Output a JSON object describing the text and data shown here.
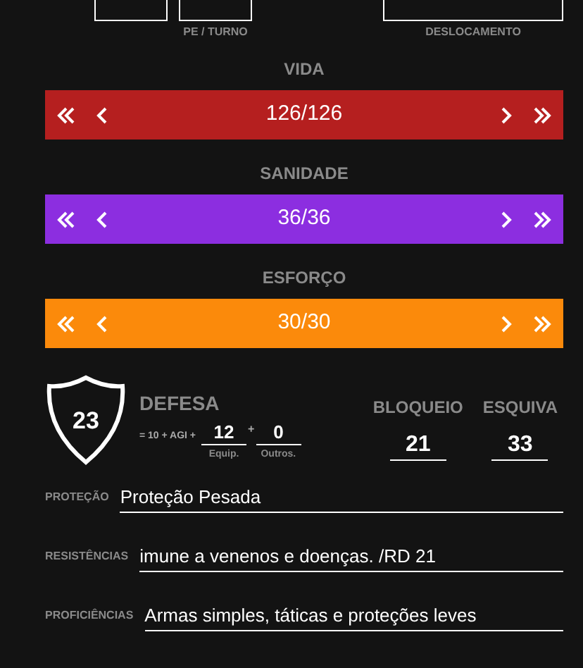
{
  "top_labels": [
    "PE / TURNO",
    "DESLOCAMENTO"
  ],
  "bars": [
    {
      "title": "VIDA",
      "value": "126/126",
      "color": "#b51f1f"
    },
    {
      "title": "SANIDADE",
      "value": "36/36",
      "color": "#8c2ee0"
    },
    {
      "title": "ESFORÇO",
      "value": "30/30",
      "color": "#fb8a0b"
    }
  ],
  "defense": {
    "value": "23",
    "title": "DEFESA",
    "formula": "= 10 + AGI +",
    "equip": "12",
    "plus": "+",
    "others": "0",
    "equip_label": "Equip.",
    "others_label": "Outros."
  },
  "stats": [
    {
      "label": "BLOQUEIO",
      "value": "21"
    },
    {
      "label": "ESQUIVA",
      "value": "33"
    }
  ],
  "fields": [
    {
      "label": "PROTEÇÃO",
      "value": "Proteção Pesada"
    },
    {
      "label": "RESISTÊNCIAS",
      "value": "imune a venenos e doenças. /RD 21"
    },
    {
      "label": "PROFICIÊNCIAS",
      "value": "Armas simples, táticas e proteções leves"
    }
  ]
}
